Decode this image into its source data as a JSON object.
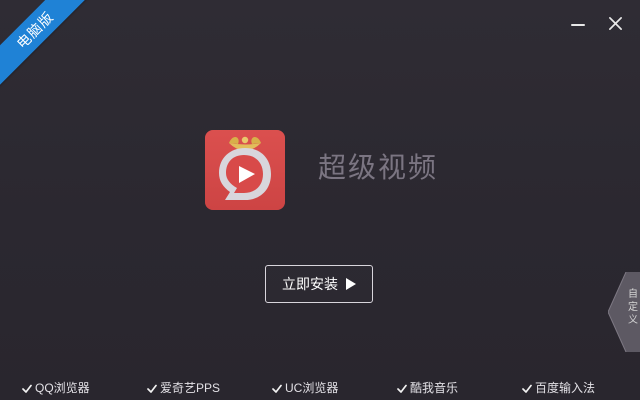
{
  "window": {
    "ribbon_text": "电脑版",
    "controls": {
      "minimize": "minimize-icon",
      "close": "close-icon"
    }
  },
  "logo": {
    "icon_name": "super-video-logo",
    "app_name": "超级视频"
  },
  "actions": {
    "install_label": "立即安装",
    "install_icon": "play-icon"
  },
  "side_tab": {
    "label": "自定义",
    "icon": "customize-tab"
  },
  "options": [
    {
      "label": "QQ浏览器",
      "checked": true
    },
    {
      "label": "爱奇艺PPS",
      "checked": true
    },
    {
      "label": "UC浏览器",
      "checked": true
    },
    {
      "label": "酷我音乐",
      "checked": true
    },
    {
      "label": "百度输入法",
      "checked": true
    }
  ],
  "colors": {
    "background": "#2e2b33",
    "ribbon": "#1f82d6",
    "logo_red": "#d84a49",
    "logo_gold": "#d8b04a",
    "text_muted": "#7b7582",
    "text_light": "#e3e1e6"
  }
}
